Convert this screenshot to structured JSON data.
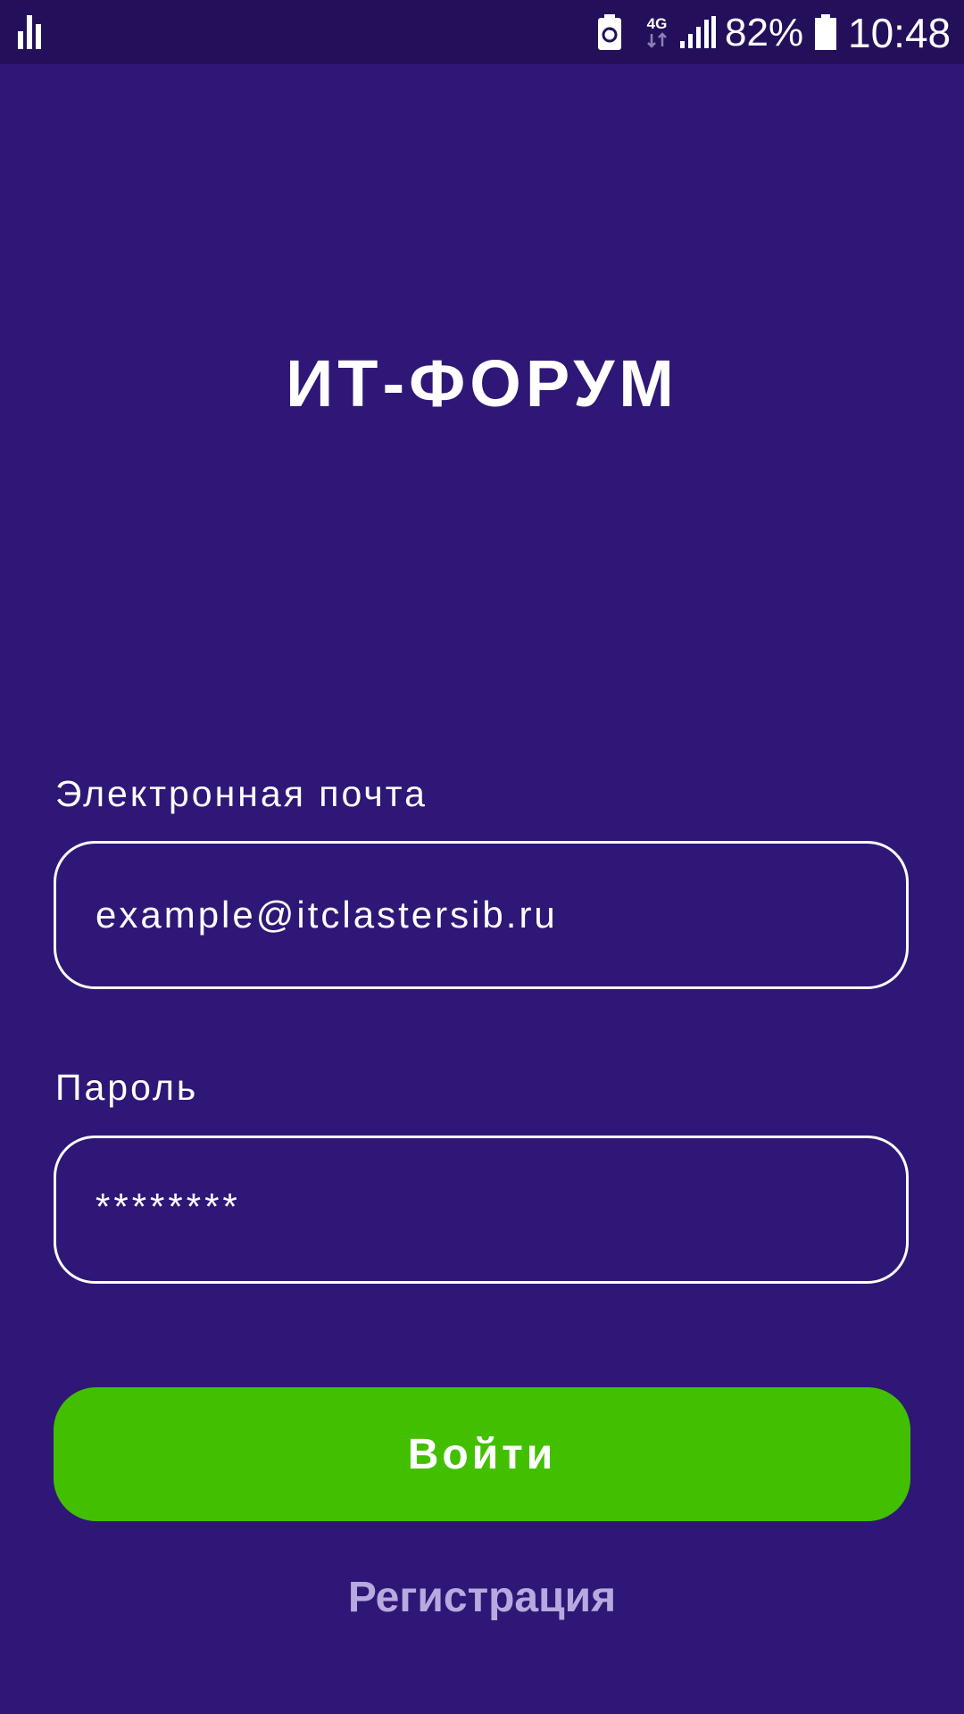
{
  "status_bar": {
    "left_icon": "equalizer-icon",
    "icons": [
      "battery-saver-icon",
      "network-4g-icon",
      "signal-icon",
      "battery-icon"
    ],
    "network_type": "4G",
    "battery_percent": "82%",
    "time": "10:48"
  },
  "app": {
    "title": "ИТ-ФОРУМ"
  },
  "form": {
    "email_label": "Электронная почта",
    "email_value": "example@itclastersib.ru",
    "password_label": "Пароль",
    "password_value": "********"
  },
  "actions": {
    "login_label": "Войти",
    "register_label": "Регистрация"
  },
  "colors": {
    "background": "#2f1777",
    "status_bar": "#24105a",
    "button": "#42c000",
    "link": "#b8a9df",
    "text": "#ffffff"
  }
}
